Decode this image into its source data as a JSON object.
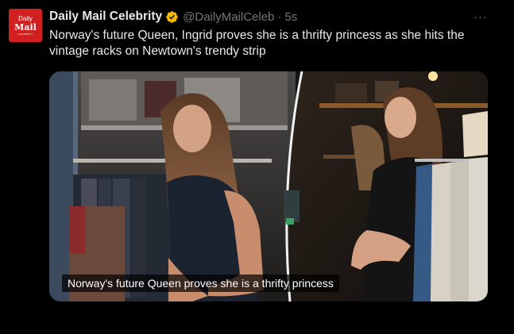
{
  "account": {
    "avatar_line1": "Daily",
    "avatar_line2": "Mail",
    "avatar_line3": "CELEBRITY",
    "display_name": "Daily Mail Celebrity",
    "handle": "@DailyMailCeleb",
    "separator": "·",
    "timestamp": "5s",
    "verified_badge_color": "#f4b800"
  },
  "menu": {
    "more_label": "···"
  },
  "tweet": {
    "text": "Norway's future Queen, Ingrid proves she is a thrifty princess as she hits the vintage racks on Newtown's trendy strip"
  },
  "media": {
    "caption": "Norway's future Queen proves she is a thrifty princess"
  },
  "colors": {
    "background": "#000000",
    "text_primary": "#e7e9ea",
    "text_secondary": "#71767b",
    "brand_red": "#d21f1f"
  }
}
